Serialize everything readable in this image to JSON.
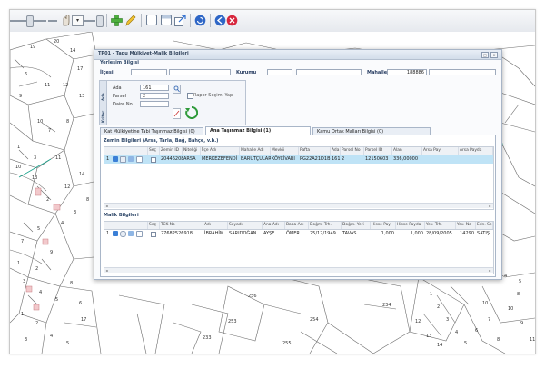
{
  "toolbar": {
    "icons": [
      "zoom-slider-icon",
      "pan-icon",
      "add-icon",
      "pencil-icon",
      "window-icon",
      "window-icon",
      "export-icon",
      "refresh-icon",
      "back-icon",
      "close-icon"
    ],
    "dropdown_glyph": "▾"
  },
  "map": {
    "parcel_labels": [
      "20",
      "19",
      "14",
      "17",
      "6",
      "11",
      "9",
      "12",
      "13",
      "10",
      "8",
      "7",
      "11",
      "1",
      "3",
      "10",
      "13",
      "14",
      "12",
      "2",
      "3",
      "4",
      "5",
      "7",
      "9",
      "1",
      "2",
      "3",
      "4",
      "5",
      "8",
      "6",
      "1",
      "2",
      "3",
      "4",
      "5",
      "17",
      "8",
      "4",
      "8",
      "10",
      "1",
      "2",
      "3",
      "4",
      "5",
      "6",
      "7",
      "8",
      "12",
      "13",
      "14",
      "10",
      "9",
      "11",
      "256",
      "253",
      "254",
      "234",
      "233",
      "255",
      "5"
    ]
  },
  "window": {
    "title": "TP01 - Tapu Mülkiyet-Malik Bilgileri",
    "controls": [
      "□",
      "×"
    ],
    "location_section": {
      "title": "Yerleşim Bilgisi",
      "ilce_label": "İlçesi",
      "kurum_label": "Kurumu",
      "mahalle_label": "Mahallesi",
      "mahalle_value": "188886",
      "ilce_value": "",
      "kurum_value": "",
      "mahalle_name": ""
    },
    "parcel_box": {
      "vtab_top": "Ada",
      "vtab_bottom": "Kriter",
      "ada_label": "Ada",
      "ada_value": "161",
      "parsel_label": "Parsel",
      "parsel_value": "2",
      "daire_label": "Daire No",
      "daire_value": "",
      "rapor_label": "Rapor Seçimi Yap"
    },
    "tabs": [
      {
        "label": "Kat Mülkiyetine Tabi Taşınmaz Bilgisi  (0)"
      },
      {
        "label": "Ana Taşınmaz Bilgisi  (1)"
      },
      {
        "label": "Kamu Ortak Malları Bilgisi  (0)"
      }
    ],
    "zemin": {
      "title": "Zemin Bilgileri (Arsa, Tarla, Bağ, Bahçe, v.b.)",
      "columns": [
        "",
        "Seç",
        "Zemin ID",
        "Niteliği",
        "İlçe Adı",
        "Mahalle Adı",
        "Mevkii",
        "Pafta",
        "Ada",
        "Parsel No",
        "Parsel ID",
        "Alan",
        "Arsa Pay",
        "Arsa Payda"
      ],
      "rows": [
        {
          "no": "1",
          "cells": [
            "20446208",
            "ARSA",
            "MERKEZEFENDİ",
            "BARUTÇULAR",
            "KÖYCİVARI",
            "PG22A21D1B",
            "161",
            "2",
            "12150603",
            "336,00000",
            "",
            ""
          ]
        }
      ]
    },
    "malik": {
      "title": "Malik Bilgileri",
      "columns": [
        "",
        "Seç",
        "TCK No",
        "Adı",
        "Soyadı",
        "Ana Adı",
        "Baba Adı",
        "Doğm. Trh.",
        "Doğm. Yeri",
        "Hisse Pay",
        "Hisse Payda",
        "Yev. Trh.",
        "Yev. No",
        "Edn. Se"
      ],
      "rows": [
        {
          "no": "1",
          "cells": [
            "27682526918",
            "İBRAHİM",
            "SARIDOĞAN",
            "AYŞE",
            "ÖMER",
            "25/12/1949",
            "TAVAS",
            "1,000",
            "1,000",
            "28/09/2005",
            "14290",
            "SATIŞ"
          ]
        }
      ]
    }
  }
}
